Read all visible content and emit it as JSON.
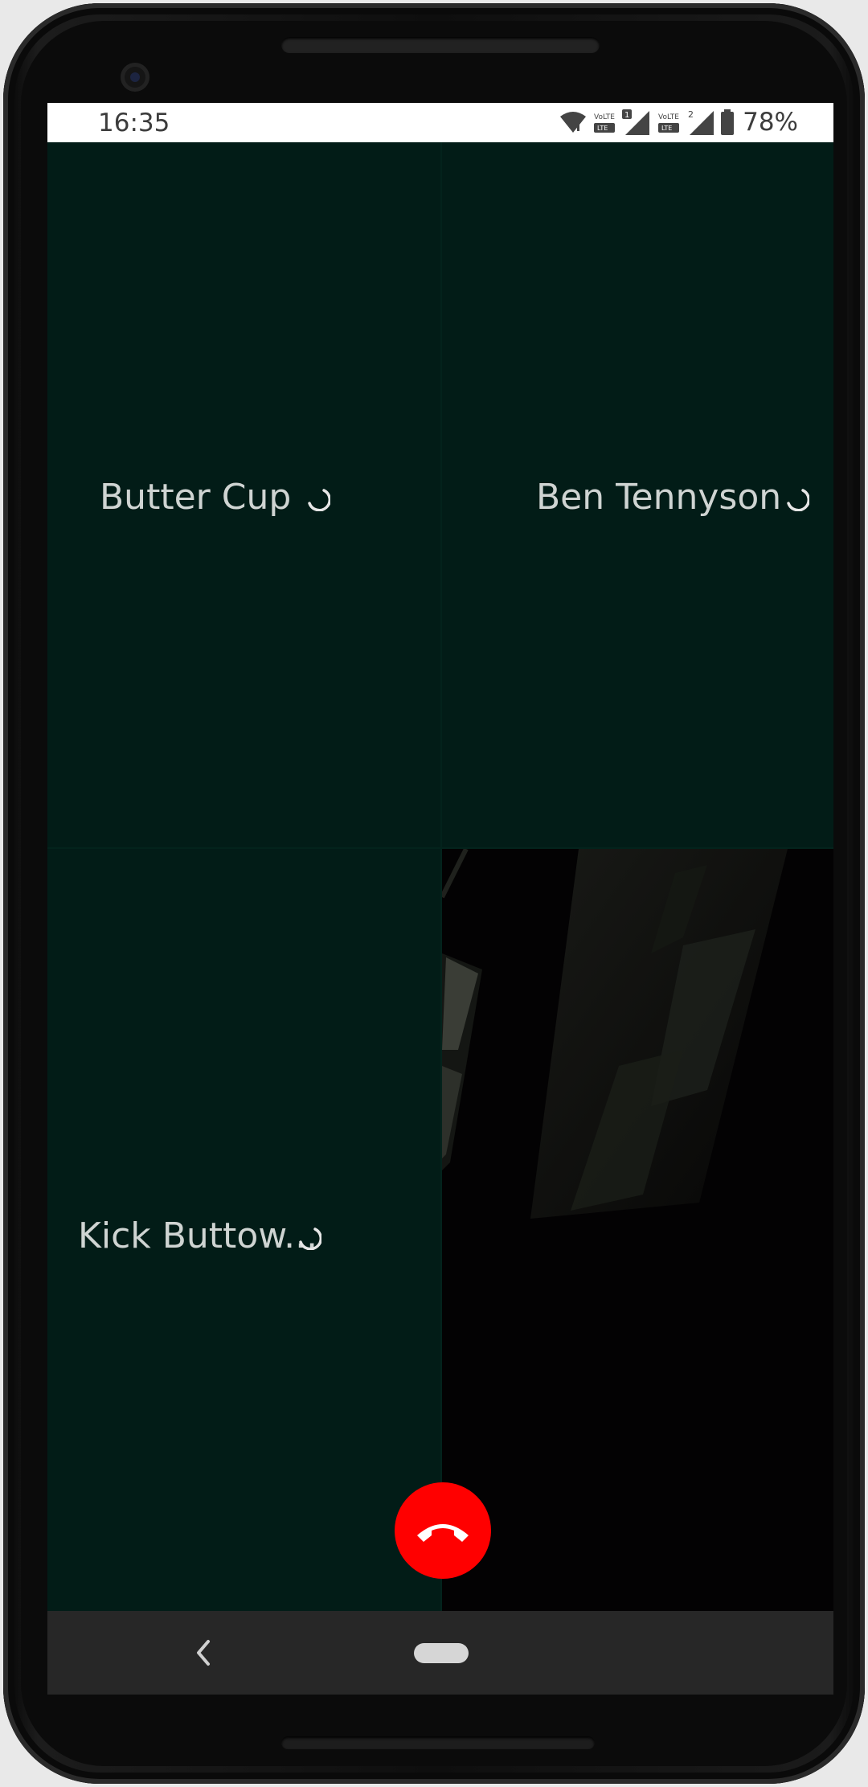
{
  "status_bar": {
    "time": "16:35",
    "battery_percent": "78%",
    "icons": [
      "wifi-icon",
      "volte-lte-icon",
      "sim-1-badge",
      "signal-icon",
      "volte-lte-icon",
      "sim-2-badge",
      "signal-icon",
      "battery-icon"
    ],
    "sim1_label": "1",
    "sim2_label": "2",
    "lte_label": "LTE",
    "volte_label": "VoLTE"
  },
  "call": {
    "participants": [
      {
        "name": "Butter Cup",
        "status": "connecting"
      },
      {
        "name": "Ben Tennyson",
        "status": "connecting"
      },
      {
        "name": "Kick Buttow...",
        "status": "connecting"
      }
    ],
    "self_view": "local-camera-preview",
    "end_call_icon": "phone-hangup-icon"
  },
  "navigation": {
    "back_icon": "back-chevron-icon",
    "home_icon": "home-pill-icon"
  },
  "colors": {
    "tile_background": "#021c17",
    "end_call": "#ff0000",
    "nav_bar": "#272727",
    "name_text": "#cfd4d2"
  }
}
